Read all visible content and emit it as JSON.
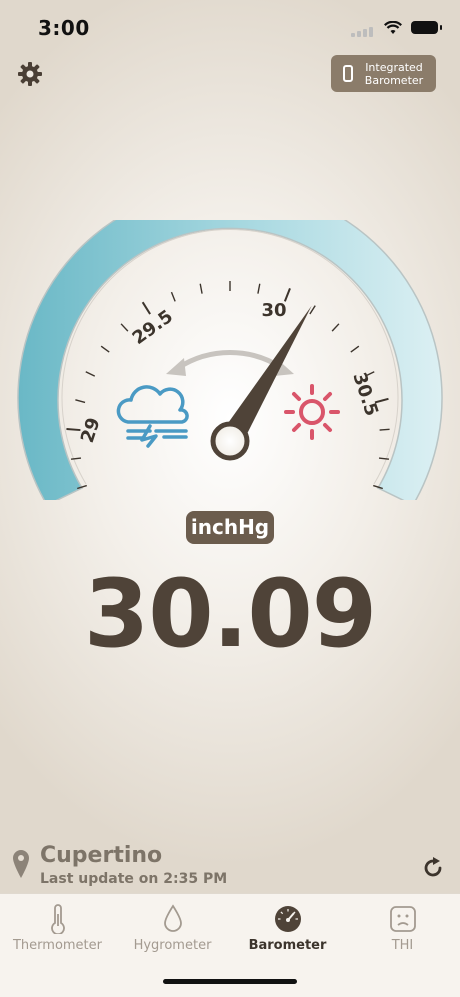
{
  "status": {
    "time": "3:00"
  },
  "header": {
    "integrated_label_line1": "Integrated",
    "integrated_label_line2": "Barometer"
  },
  "gauge": {
    "labels": {
      "l29": "29",
      "l295": "29.5",
      "l30": "30",
      "l305": "30.5"
    },
    "needle_value": 30.09,
    "scale_min": 28.7,
    "scale_max": 30.9,
    "icons": [
      "rain-cloud-icon",
      "sun-icon"
    ]
  },
  "reading": {
    "unit": "inchHg",
    "value": "30.09"
  },
  "location": {
    "name": "Cupertino",
    "update": "Last update on 2:35 PM"
  },
  "tabs": [
    {
      "label": "Thermometer",
      "icon": "thermometer-icon",
      "active": false
    },
    {
      "label": "Hygrometer",
      "icon": "drop-icon",
      "active": false
    },
    {
      "label": "Barometer",
      "icon": "barometer-icon",
      "active": true
    },
    {
      "label": "THI",
      "icon": "thi-face-icon",
      "active": false
    }
  ],
  "colors": {
    "arc_start": "#6ab8c6",
    "arc_end": "#d9eff2",
    "needle": "#4f4338",
    "rain_icon": "#4a9ac4",
    "sun_icon": "#d9556a",
    "badge": "#6b5c4d"
  }
}
